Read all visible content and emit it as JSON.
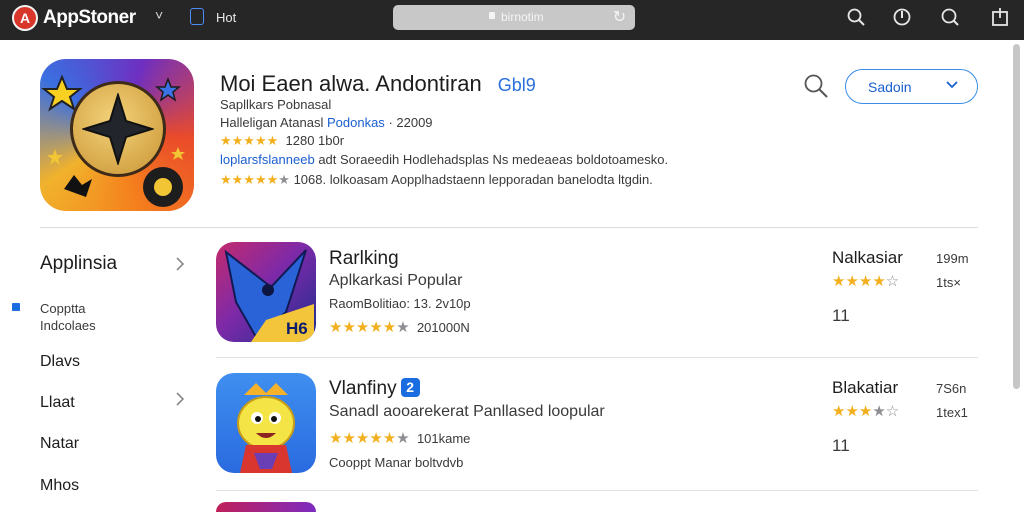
{
  "topbar": {
    "brand_name": "AppStoner",
    "brand_menu": "˅",
    "tab_label": "Hot",
    "url": "birnotim"
  },
  "header": {
    "title": "Moi Eaen alwa. Andontiran",
    "title_badge": "Gbl9",
    "subtitle": "Sapllkars Pobnasal",
    "developer": "Halleligan Atanasl",
    "developer_link": "Podonkas",
    "developer_year": "· 22009",
    "rating_text": "1280 1b0r",
    "tags_link": "loplarsfslanneeb",
    "tags_text": "adt Soraeedih Hodlehadsplas Ns medeaeas boldotoamesko.",
    "rating2_text": "1068. lolkoasam Aopplhadstaenn lepporadan banelodta ltgdin.",
    "select_label": "Sadoin"
  },
  "sidebar": {
    "heading": "Applinsia",
    "items": [
      {
        "label": "Copptta",
        "sub": "Indcolaes"
      },
      {
        "label": "Dlavs"
      },
      {
        "label": "Llaat"
      },
      {
        "label": "Natar"
      },
      {
        "label": "Mhos"
      }
    ]
  },
  "rows": [
    {
      "title": "Rarlking",
      "subtitle": "Aplkarkasi Popular",
      "meta": "RaomBolitiao: 13. 2v10p",
      "rating_count": "201000N",
      "right_title": "Nalkasiar",
      "right_count": "11",
      "right_small_1": "199m",
      "right_small_2": "1ts×"
    },
    {
      "title": "Vlanfiny",
      "title_badge": "2",
      "subtitle": "Sanadl aooarekerat Panllased loopular",
      "meta": "101kame",
      "extra": "Cooppt Manar boltvdvb",
      "right_title": "Blakatiar",
      "right_count": "11",
      "right_small_1": "7S6n",
      "right_small_2": "1tex1"
    }
  ],
  "icons": {
    "menu": "chevron-down-icon",
    "search": "search-icon",
    "power": "power-icon",
    "share": "share-icon"
  },
  "colors": {
    "accent": "#1a6de0",
    "star": "#f2b01e",
    "topbar": "#262626"
  }
}
